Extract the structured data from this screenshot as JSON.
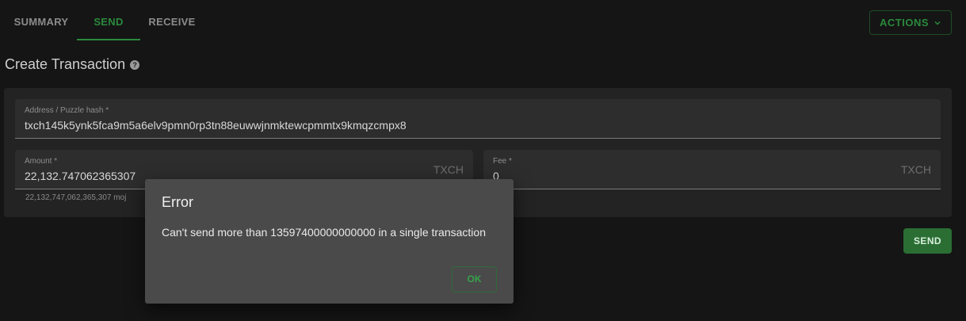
{
  "tabs": [
    {
      "label": "SUMMARY"
    },
    {
      "label": "SEND"
    },
    {
      "label": "RECEIVE"
    }
  ],
  "header": {
    "actions_label": "ACTIONS"
  },
  "page": {
    "title": "Create Transaction",
    "help_icon": "?"
  },
  "form": {
    "address": {
      "label": "Address / Puzzle hash *",
      "value": "txch145k5ynk5fca9m5a6elv9pmn0rp3tn88euwwjnmktewcpmmtx9kmqzcmpx8"
    },
    "amount": {
      "label": "Amount *",
      "value": "22,132.747062365307",
      "unit": "TXCH",
      "helper": "22,132,747,062,365,307   moj"
    },
    "fee": {
      "label": "Fee *",
      "value": "0",
      "unit": "TXCH"
    },
    "send_label": "SEND"
  },
  "dialog": {
    "title": "Error",
    "message": "Can't send more than 13597400000000000 in a single transaction",
    "ok_label": "OK"
  },
  "colors": {
    "accent": "#2a8a3c",
    "background": "#1a1a1a",
    "dialog_bg": "#4a4a4a"
  }
}
